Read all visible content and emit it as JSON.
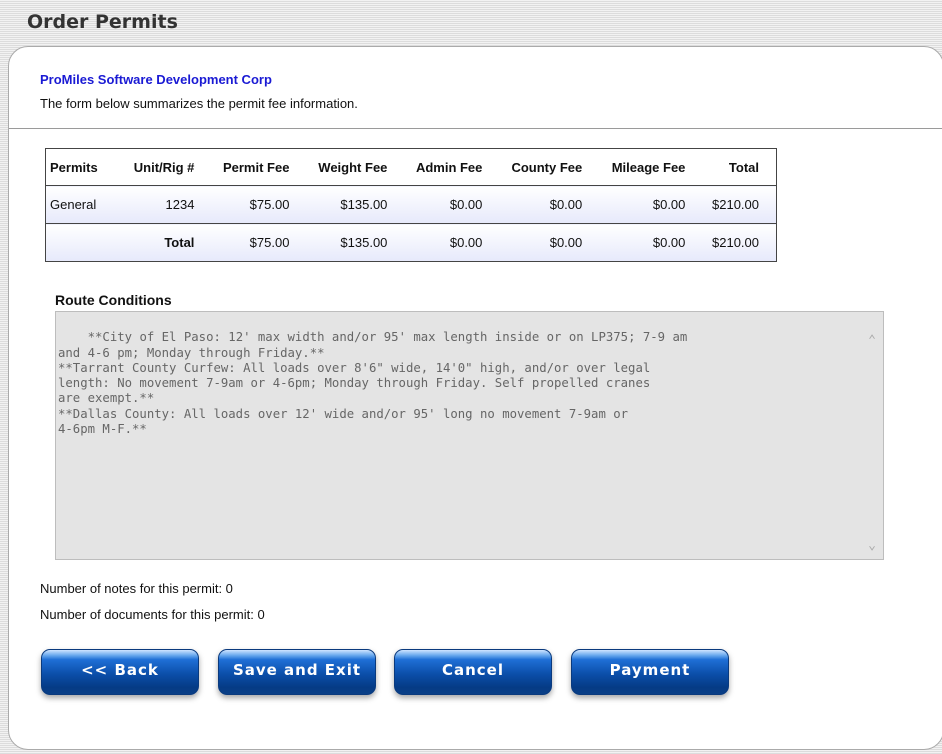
{
  "header": {
    "title": "Order Permits"
  },
  "company": {
    "name": "ProMiles Software Development Corp"
  },
  "summary": {
    "text": "The form below summarizes the permit fee information."
  },
  "fees": {
    "columns": [
      "Permits",
      "Unit/Rig #",
      "Permit Fee",
      "Weight Fee",
      "Admin Fee",
      "County Fee",
      "Mileage Fee",
      "Total"
    ],
    "rows": [
      [
        "General",
        "1234",
        "$75.00",
        "$135.00",
        "$0.00",
        "$0.00",
        "$0.00",
        "$210.00"
      ]
    ],
    "total": [
      "",
      "Total",
      "$75.00",
      "$135.00",
      "$0.00",
      "$0.00",
      "$0.00",
      "$210.00"
    ]
  },
  "route": {
    "label": "Route Conditions",
    "text": "**City of El Paso: 12' max width and/or 95' max length inside or on LP375; 7-9 am\nand 4-6 pm; Monday through Friday.**\n**Tarrant County Curfew: All loads over 8'6\" wide, 14'0\" high, and/or over legal\nlength: No movement 7-9am or 4-6pm; Monday through Friday. Self propelled cranes\nare exempt.**\n**Dallas County: All loads over 12' wide and/or 95' long no movement 7-9am or\n4-6pm M-F.**"
  },
  "notes": {
    "notes_line": "Number of notes for this permit: 0",
    "documents_line": "Number of documents for this permit: 0"
  },
  "buttons": {
    "back": "<< Back",
    "save_exit": "Save and Exit",
    "cancel": "Cancel",
    "payment": "Payment"
  }
}
